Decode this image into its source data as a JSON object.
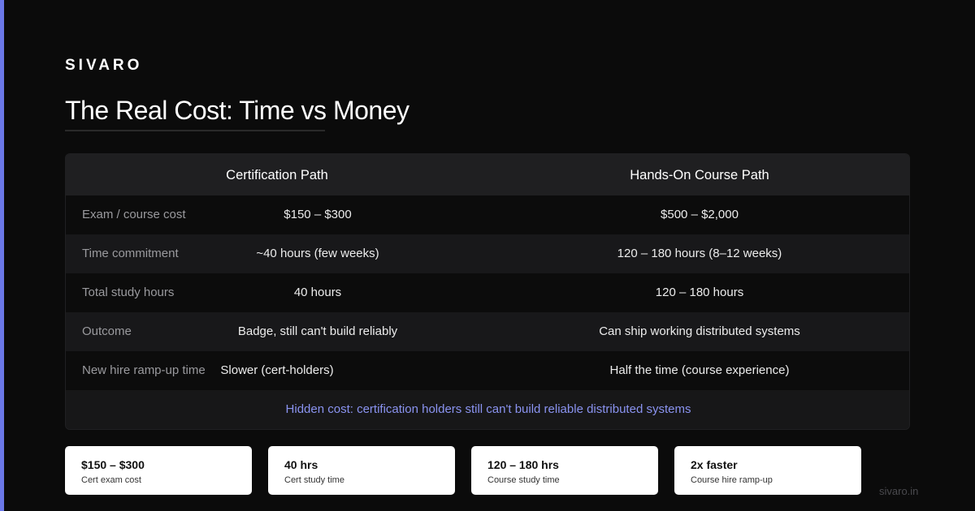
{
  "brand": "SIVARO",
  "title": "The Real Cost: Time vs Money",
  "table": {
    "headers": {
      "certification": "Certification Path",
      "course": "Hands-On Course Path"
    },
    "rows": [
      {
        "label": "Exam / course cost",
        "certification": "$150 – $300",
        "course": "$500 – $2,000"
      },
      {
        "label": "Time commitment",
        "certification": "~40 hours (few weeks)",
        "course": "120 – 180 hours (8–12 weeks)"
      },
      {
        "label": "Total study hours",
        "certification": "40 hours",
        "course": "120 – 180 hours"
      },
      {
        "label": "Outcome",
        "certification": "Badge, still can't build reliably",
        "course": "Can ship working distributed systems"
      },
      {
        "label": "New hire ramp-up time",
        "certification": "Slower (cert-holders)",
        "course": "Half the time (course experience)"
      }
    ],
    "footer_note": "Hidden cost: certification holders still can't build reliable distributed systems"
  },
  "cards": [
    {
      "value": "$150 – $300",
      "label": "Cert exam cost"
    },
    {
      "value": "40 hrs",
      "label": "Cert study time"
    },
    {
      "value": "120 – 180 hrs",
      "label": "Course study time"
    },
    {
      "value": "2x faster",
      "label": "Course hire ramp-up"
    }
  ],
  "site": "sivaro.in",
  "colors": {
    "accent": "#6b78e8",
    "background": "#0b0b0b",
    "highlight_text": "#8a93f0"
  }
}
